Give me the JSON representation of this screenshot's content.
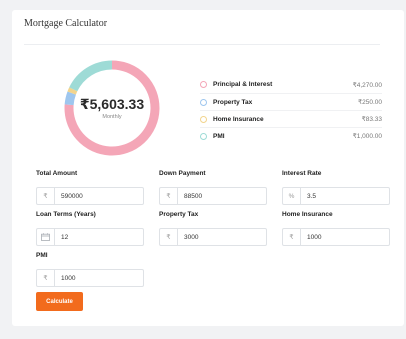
{
  "calculator": {
    "title": "Mortgage Calculator",
    "monthly_amount": "₹5,603.33",
    "monthly_label": "Monthly"
  },
  "breakdown": [
    {
      "label": "Principal & Interest",
      "value": "₹4,270.00",
      "amount": 4270.0,
      "color": "#f4a6b7"
    },
    {
      "label": "Property Tax",
      "value": "₹250.00",
      "amount": 250.0,
      "color": "#9ec6ee"
    },
    {
      "label": "Home Insurance",
      "value": "₹83.33",
      "amount": 83.33,
      "color": "#f2d48d"
    },
    {
      "label": "PMI",
      "value": "₹1,000.00",
      "amount": 1000.0,
      "color": "#9edbd6"
    }
  ],
  "fields": {
    "total_amount": {
      "label": "Total Amount",
      "prefix": "₹",
      "value": "590000"
    },
    "down_payment": {
      "label": "Down Payment",
      "prefix": "₹",
      "value": "88500"
    },
    "interest_rate": {
      "label": "Interest Rate",
      "prefix": "%",
      "value": "3.5"
    },
    "loan_terms": {
      "label": "Loan Terms (Years)",
      "prefix_icon": "calendar-icon",
      "value": "12"
    },
    "property_tax": {
      "label": "Property Tax",
      "prefix": "₹",
      "value": "3000"
    },
    "home_insurance": {
      "label": "Home Insurance",
      "prefix": "₹",
      "value": "1000"
    },
    "pmi": {
      "label": "PMI",
      "prefix": "₹",
      "value": "1000"
    }
  },
  "actions": {
    "calculate_label": "Calculate"
  }
}
